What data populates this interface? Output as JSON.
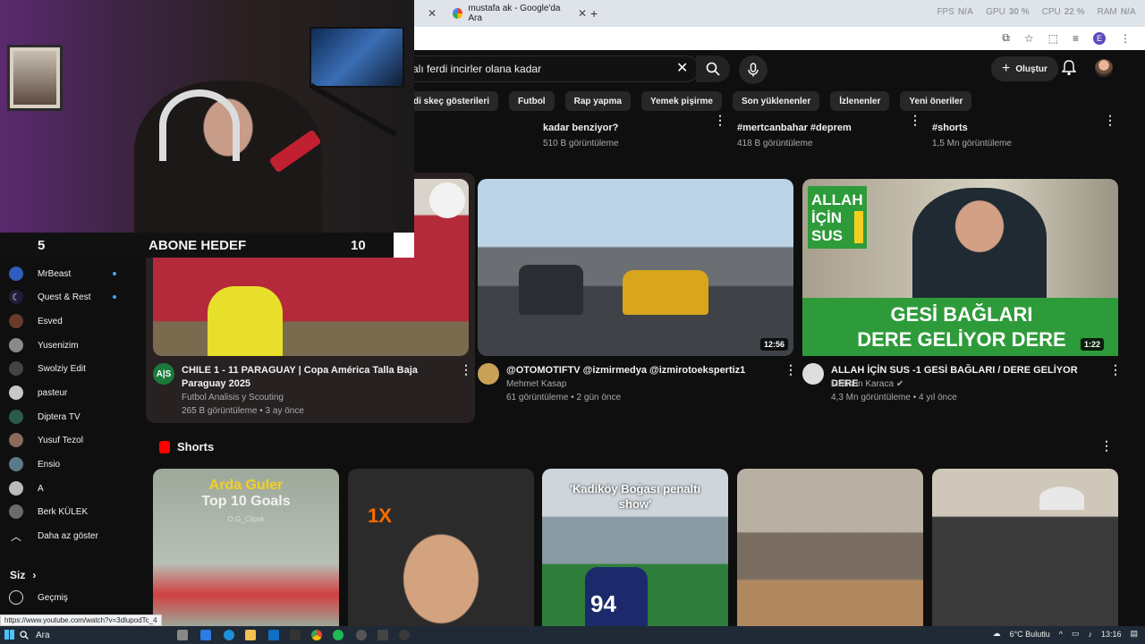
{
  "browser": {
    "tab_active_title": "mustafa ak - Google'da Ara",
    "perf": {
      "fps_label": "FPS",
      "fps_value": "N/A",
      "gpu_label": "GPU",
      "gpu_value": "30 %",
      "cpu_label": "CPU",
      "cpu_value": "22 %",
      "ram_label": "RAM",
      "ram_value": "N/A"
    }
  },
  "search": {
    "query": "alı ferdi incirler olana kadar"
  },
  "header": {
    "create_label": "Oluştur"
  },
  "chips": [
    "di skeç gösterileri",
    "Futbol",
    "Rap yapma",
    "Yemek pişirme",
    "Son yüklenenler",
    "İzlenenler",
    "Yeni öneriler"
  ],
  "top_row": [
    {
      "title": "kadar benziyor?",
      "meta": "510 B görüntüleme"
    },
    {
      "title": "#mertcanbahar #deprem",
      "meta": "418 B görüntüleme"
    },
    {
      "title": "#shorts",
      "meta": "1,5 Mn görüntüleme"
    }
  ],
  "overlay": {
    "left_number": "5",
    "label": "ABONE HEDEF",
    "right_number": "10"
  },
  "sidebar": {
    "items": [
      {
        "label": "MrBeast",
        "color": "#2f5dbd",
        "new": true
      },
      {
        "label": "Quest & Rest",
        "color": "#3b3b5a",
        "new": true
      },
      {
        "label": "Esved",
        "color": "#6a3a2a",
        "new": false
      },
      {
        "label": "Yusenizim",
        "color": "#8a8a8a",
        "new": false
      },
      {
        "label": "Swolziy Edit",
        "color": "#444",
        "new": false
      },
      {
        "label": "pasteur",
        "color": "#c9c9c9",
        "new": false
      },
      {
        "label": "Diptera TV",
        "color": "#2a5a4a",
        "new": false
      },
      {
        "label": "Yusuf Tezol",
        "color": "#8a6a5a",
        "new": false
      },
      {
        "label": "Ensio",
        "color": "#5a7a8a",
        "new": false
      },
      {
        "label": "A",
        "color": "#bbbbbb",
        "new": false
      },
      {
        "label": "Berk KÜLEK",
        "color": "#6a6a6a",
        "new": false
      }
    ],
    "less_label": "Daha az göster",
    "you_label": "Siz",
    "history_label": "Geçmiş"
  },
  "videos": [
    {
      "title": "CHILE 1 - 11 PARAGUAY | Copa América Talla Baja Paraguay 2025",
      "channel": "Futbol Analisis y Scouting",
      "meta": "265 B görüntüleme • 3 ay önce",
      "duration": "",
      "avatar_text": "A|S"
    },
    {
      "title": "@OTOMOTIFTV @izmirmedya @izmirotoekspertiz1",
      "channel": "Mehmet Kasap",
      "meta": "61 görüntüleme • 2 gün önce",
      "duration": "12:56"
    },
    {
      "title": "ALLAH İÇİN SUS -1 GESİ BAĞLARI / DERE GELİYOR DERE",
      "channel": "Mahsun Karaca",
      "meta": "4,3 Mn görüntüleme • 4 yıl önce",
      "duration": "1:22",
      "thumb_badge": "ALLAH İÇİN SUS",
      "thumb_text_1": "GESİ BAĞLARI",
      "thumb_text_2": "DERE GELİYOR DERE"
    }
  ],
  "shorts": {
    "heading": "Shorts",
    "items": [
      {
        "line1": "Arda Guler",
        "line2": "Top 10 Goals",
        "watermark": "O.G_Clipsk"
      },
      {
        "badge": "1X"
      },
      {
        "caption": "'Kadıköy Boğası penaltı show'",
        "number": "94"
      },
      {},
      {}
    ]
  },
  "status_url": "https://www.youtube.com/watch?v=3dlupodTc_4",
  "taskbar": {
    "search_label": "Ara",
    "weather": "6°C Bulutlu",
    "time": "13:16"
  }
}
